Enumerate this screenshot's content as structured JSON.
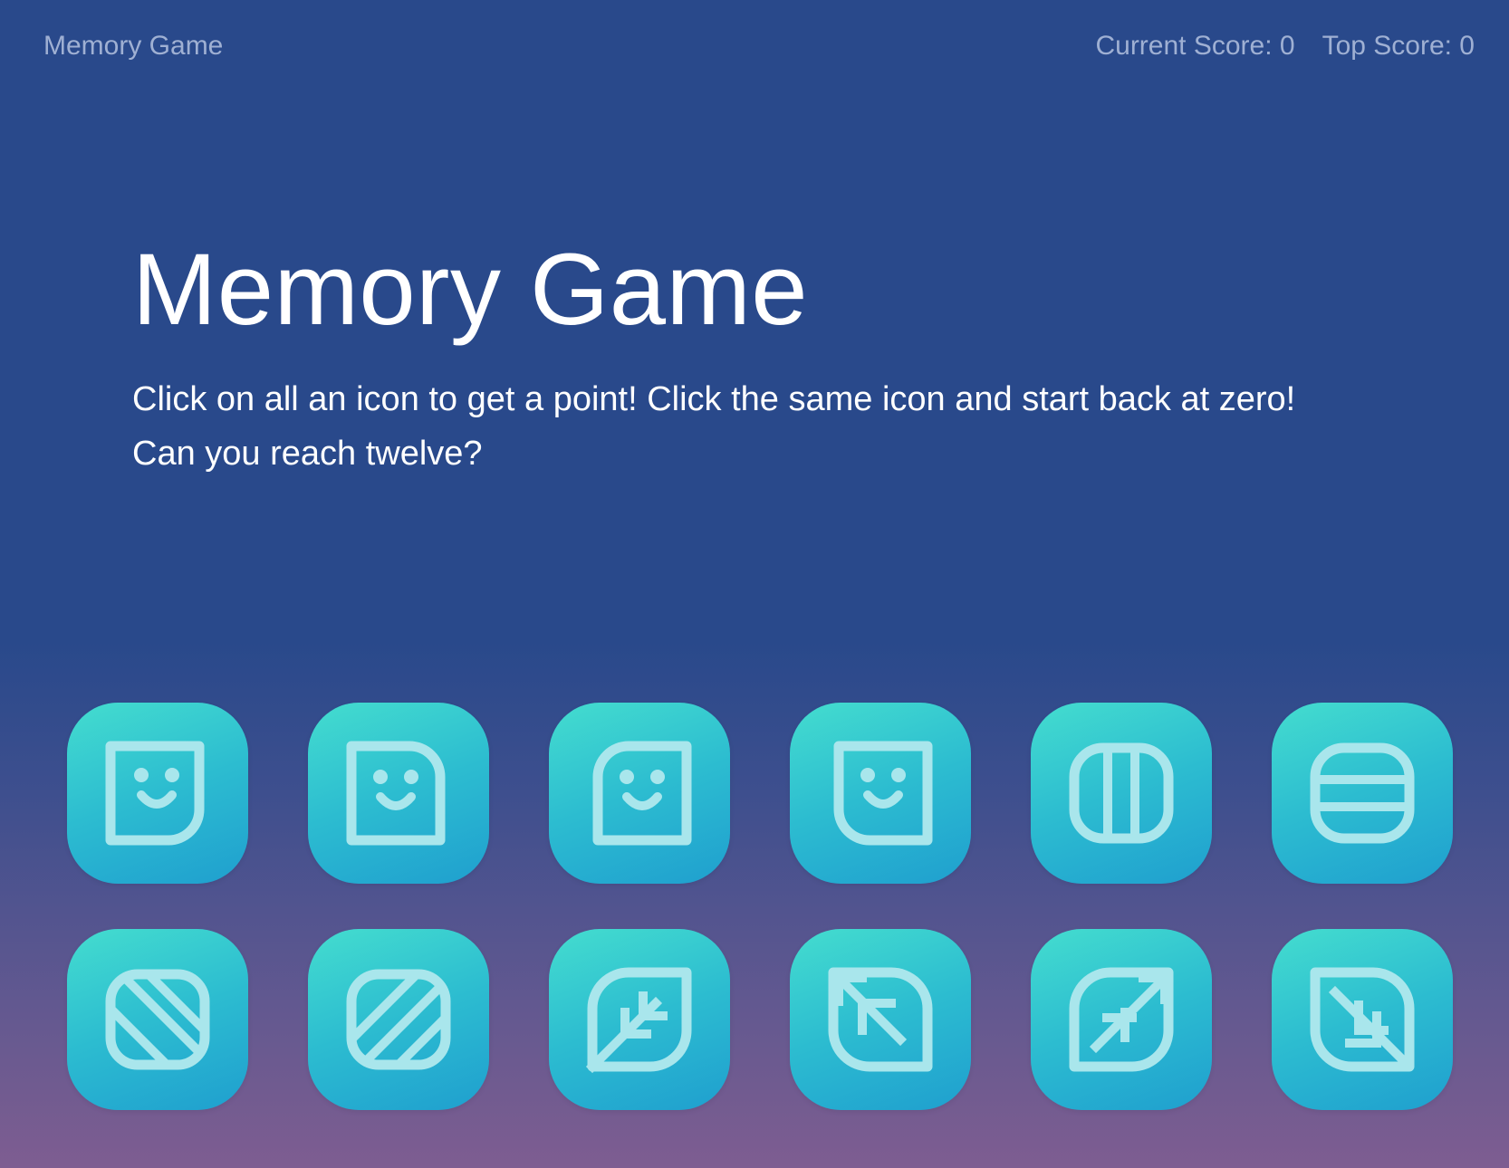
{
  "navbar": {
    "brand": "Memory Game",
    "current_score": "Current Score: 0",
    "top_score": "Top Score: 0"
  },
  "hero": {
    "title": "Memory Game",
    "line1": "Click on all an icon to get a point! Click the same icon and start back at zero!",
    "line2": "Can you reach twelve?"
  },
  "colors": {
    "background_top": "#29498b",
    "background_bottom": "#7e5d91",
    "card_gradient_start": "#44ddcf",
    "card_gradient_end": "#1f9fcf",
    "icon_stroke": "#a9e6ec"
  },
  "cards": [
    {
      "icon": "smiley-br-round-icon"
    },
    {
      "icon": "smiley-tr-round-icon"
    },
    {
      "icon": "smiley-tl-round-icon"
    },
    {
      "icon": "smiley-bl-round-icon"
    },
    {
      "icon": "vertical-stripes-icon"
    },
    {
      "icon": "horizontal-stripes-icon"
    },
    {
      "icon": "diagonal-stripes-down-icon"
    },
    {
      "icon": "diagonal-stripes-up-icon"
    },
    {
      "icon": "leaf-arrow-down-left-icon"
    },
    {
      "icon": "leaf-arrow-up-left-icon"
    },
    {
      "icon": "leaf-arrow-up-right-icon"
    },
    {
      "icon": "leaf-arrow-down-right-icon"
    }
  ]
}
